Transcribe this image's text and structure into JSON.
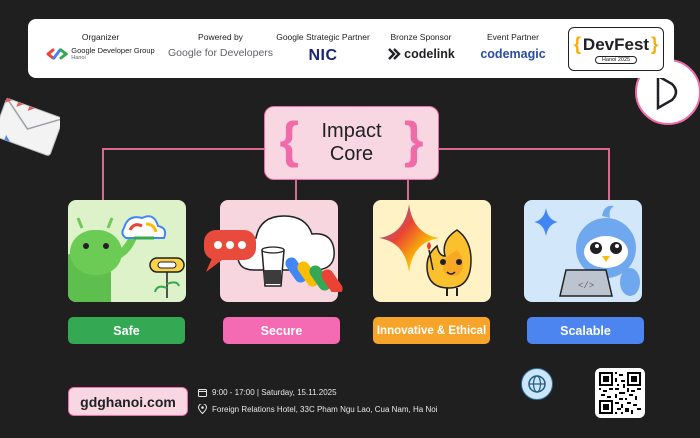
{
  "sponsors": {
    "organizer": {
      "label": "Organizer",
      "name": "Google Developer Group",
      "sub": "Hanoi"
    },
    "powered_by": {
      "label": "Powered by",
      "name": "Google for Developers"
    },
    "strategic_partner": {
      "label": "Google Strategic Partner",
      "name": "NIC"
    },
    "bronze_sponsor": {
      "label": "Bronze Sponsor",
      "name": "codelink"
    },
    "event_partner": {
      "label": "Event Partner",
      "name": "codemagic"
    },
    "event": {
      "name": "DevFest",
      "sub": "Hanoi 2025"
    }
  },
  "core": {
    "title": "Impact Core"
  },
  "pillars": [
    {
      "label": "Safe",
      "color": "#34a853"
    },
    {
      "label": "Secure",
      "color": "#f46ab3"
    },
    {
      "label": "Innovative & Ethical",
      "color": "#f6a42a"
    },
    {
      "label": "Scalable",
      "color": "#4c84f0"
    }
  ],
  "footer": {
    "url": "gdghanoi.com",
    "datetime": "9:00 - 17:00 | Saturday, 15.11.2025",
    "location": "Foreign Relations Hotel, 33C Pham Ngu Lao, Cua Nam, Ha Noi"
  },
  "icons": [
    "calendar-icon",
    "location-pin-icon",
    "globe-icon",
    "qr-code"
  ]
}
